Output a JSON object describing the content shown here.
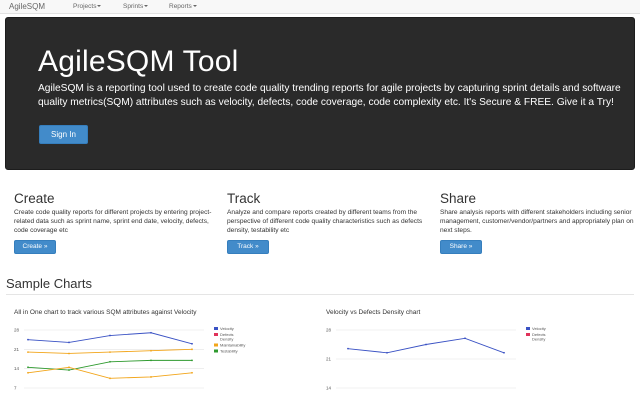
{
  "navbar": {
    "brand": "AgileSQM",
    "items": [
      {
        "label": "Projects"
      },
      {
        "label": "Sprints"
      },
      {
        "label": "Reports"
      }
    ]
  },
  "jumbotron": {
    "title": "AgileSQM Tool",
    "description": "AgileSQM is a reporting tool used to create code quality trending reports for agile projects by capturing sprint details and software quality metrics(SQM) attributes such as velocity, defects, code coverage, code complexity etc. It's Secure & FREE. Give it a Try!",
    "signin_label": "Sign In"
  },
  "features": [
    {
      "title": "Create",
      "description": "Create code quality reports for different projects by entering project-related data such as sprint name, sprint end date, velocity, defects, code coverage etc",
      "button": "Create »"
    },
    {
      "title": "Track",
      "description": "Analyze and compare reports created by different teams from the perspective of different code quality characteristics such as defects density, testability etc",
      "button": "Track »"
    },
    {
      "title": "Share",
      "description": "Share analysis reports with different stakeholders including senior management, customer/vendor/partners and appropriately plan on next steps.",
      "button": "Share »"
    }
  ],
  "sample_charts": {
    "heading": "Sample Charts"
  },
  "chart_data": [
    {
      "type": "line",
      "title": "All in One chart to track various SQM attributes against Velocity",
      "xlabel": "",
      "ylabel": "",
      "ylim": [
        7,
        28
      ],
      "yticks": [
        "28",
        "21",
        "14",
        "7"
      ],
      "x": [
        1,
        2,
        3,
        4,
        5
      ],
      "grid": true,
      "legend_position": "right",
      "series": [
        {
          "name": "Velocity",
          "color": "#3a52c4",
          "values": [
            24.5,
            23.5,
            26,
            27,
            23
          ]
        },
        {
          "name": "Defects Density",
          "color": "#e0325a",
          "values": [
            null,
            null,
            null,
            null,
            null
          ]
        },
        {
          "name": "Maintainability",
          "color": "#f2a51a",
          "values": [
            20,
            19.5,
            20,
            20.5,
            21
          ]
        },
        {
          "name": "Testability",
          "color": "#2e9a2e",
          "values": [
            14.5,
            13.5,
            16.5,
            17,
            17
          ]
        },
        {
          "name": "",
          "color": "#f2a51a",
          "values": [
            12.5,
            14.5,
            10.5,
            11,
            12.5
          ]
        }
      ]
    },
    {
      "type": "line",
      "title": "Velocity vs Defects Density chart",
      "xlabel": "",
      "ylabel": "",
      "ylim": [
        14,
        28
      ],
      "yticks": [
        "28",
        "21",
        "14"
      ],
      "x": [
        1,
        2,
        3,
        4,
        5
      ],
      "grid": true,
      "legend_position": "right",
      "series": [
        {
          "name": "Velocity",
          "color": "#3a52c4",
          "values": [
            23.5,
            22.5,
            24.5,
            26,
            22.5
          ]
        },
        {
          "name": "Defects Density",
          "color": "#e0325a",
          "values": [
            null,
            null,
            null,
            null,
            null
          ]
        }
      ]
    }
  ]
}
